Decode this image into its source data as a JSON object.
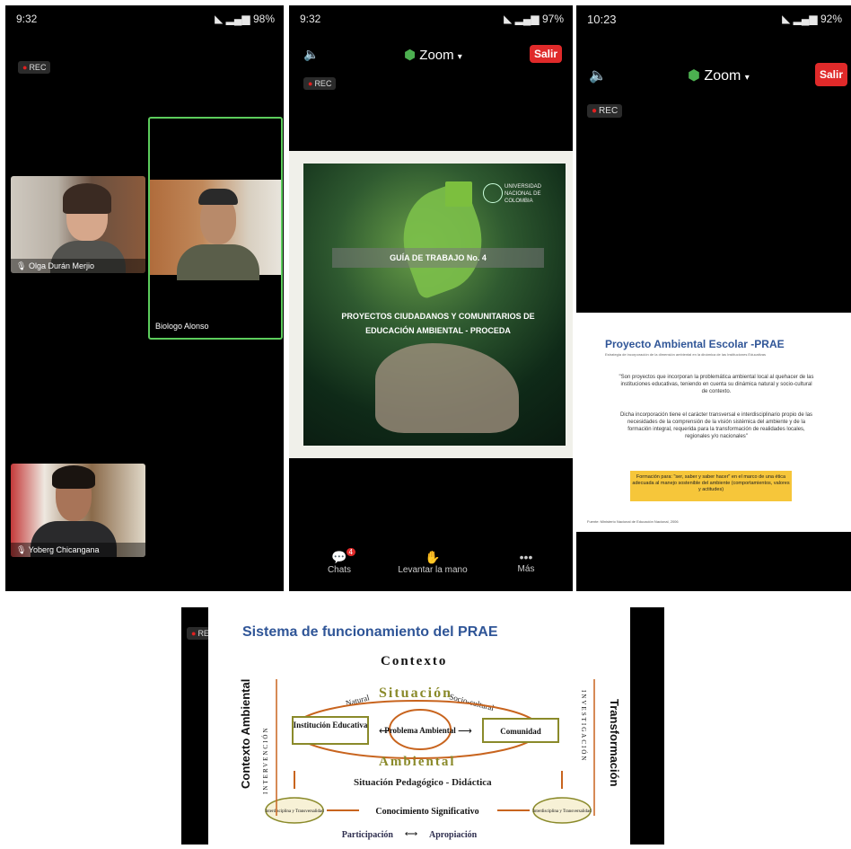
{
  "phone1": {
    "time": "9:32",
    "battery": "98%",
    "rec_label": "REC",
    "participants": [
      {
        "name": "Olga Durán Merjio"
      },
      {
        "name": "Biologo Alonso"
      },
      {
        "name": "Yoberg Chicangana"
      }
    ]
  },
  "phone2": {
    "time": "9:32",
    "battery": "97%",
    "rec_label": "REC",
    "app_title": "Zoom",
    "leave_label": "Salir",
    "guide_label": "GUÍA DE TRABAJO No. 4",
    "guide_title": "PROYECTOS CIUDADANOS Y COMUNITARIOS DE EDUCACIÓN AMBIENTAL - PROCEDA",
    "university": "UNIVERSIDAD NACIONAL DE COLOMBIA",
    "toolbar": {
      "chat_label": "Chats",
      "chat_badge": "4",
      "raise_hand_label": "Levantar la mano",
      "more_label": "Más"
    }
  },
  "phone3": {
    "time": "10:23",
    "battery": "92%",
    "rec_label": "REC",
    "app_title": "Zoom",
    "leave_label": "Salir",
    "slide_title": "Proyecto Ambiental Escolar -PRAE",
    "slide_subtitle": "Estrategia de incorporación de la dimensión ambiental en la dinámica de las Instituciones Educativas",
    "quote_1": "\"Son proyectos que incorporan la problemática ambiental local al quehacer de las instituciones educativas, teniendo en cuenta su dinámica natural y socio-cultural de contexto.",
    "quote_2": "Dicha incorporación tiene el carácter transversal e interdisciplinario propio de las necesidades de la comprensión de la visión sistémica del ambiente y de la formación integral, requerida para la transformación de realidades locales, regionales y/o nacionales\"",
    "highlight_text": "Formación para: \"ser, saber y saber hacer\" en el marco de una ética adecuada al manejo sostenible del ambiente (comportamientos, valores y actitudes)",
    "source_text": "Fuente: Ministerio Nacional de Educación Nacional, 2006"
  },
  "diagram": {
    "rec_label": "REC",
    "title": "Sistema de funcionamiento del PRAE",
    "contexto": "Contexto",
    "situacion": "Situación",
    "natural": "Natural",
    "socio_cultural": "Socio-cultural",
    "institucion": "Institución Educativa",
    "problema": "Problema Ambiental",
    "comunidad": "Comunidad",
    "ambiental": "Ambiental",
    "situacion_pedagogica": "Situación Pedagógico - Didáctica",
    "interdisciplina": "Interdisciplina y Transversalidad",
    "conocimiento": "Conocimiento Significativo",
    "participacion": "Participación",
    "apropiacion": "Apropiación",
    "contexto_ambiental": "Contexto Ambiental",
    "intervencion": "INTERVENCIÓN",
    "investigacion": "INVESTIGACIÓN",
    "transformacion": "Transformación"
  },
  "colors": {
    "zoom_green": "#4caf50",
    "leave_red": "#e02a2a",
    "prae_blue": "#2f5597",
    "highlight_yellow": "#f6c63a",
    "diagram_orange": "#c8641e",
    "diagram_olive": "#8a8a2a"
  }
}
